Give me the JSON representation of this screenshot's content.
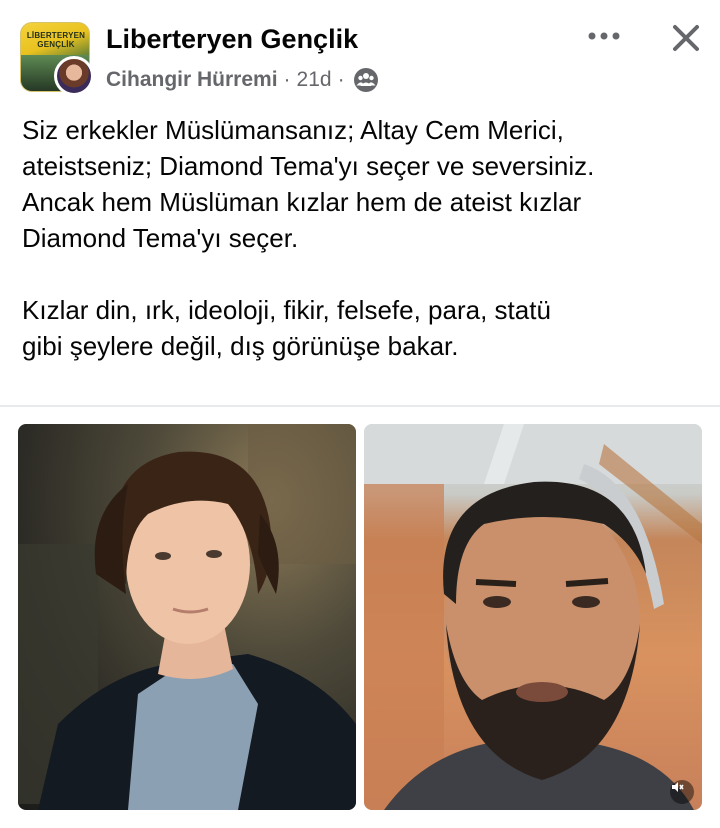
{
  "post": {
    "group_name": "Liberteryen Gençlik",
    "group_logo_text": "LİBERTERYEN GENÇLİK",
    "author": "Cihangir Hürremi",
    "time": "21d",
    "separator": "·",
    "audience_icon": "group-audience-icon",
    "more_icon": "more-dots-icon",
    "close_icon": "close-icon",
    "body_lines": [
      "Siz erkekler Müslümansanız; Altay Cem Merici,",
      "ateistseniz; Diamond Tema'yı seçer ve seversiniz.",
      "Ancak hem Müslüman kızlar hem de ateist kızlar",
      "Diamond Tema'yı seçer.",
      "",
      "Kızlar din, ırk, ideoloji, fikir, felsefe, para, statü",
      "gibi şeylere değil, dış görünüşe bakar."
    ]
  },
  "media": {
    "images": [
      "young-man-curly-hair-photo",
      "bearded-man-selfie-photo"
    ],
    "video_icon": "muted-speaker-icon"
  },
  "colors": {
    "text": "#050505",
    "secondary_text": "#65676b",
    "divider": "#e9eaed",
    "background": "#ffffff"
  }
}
